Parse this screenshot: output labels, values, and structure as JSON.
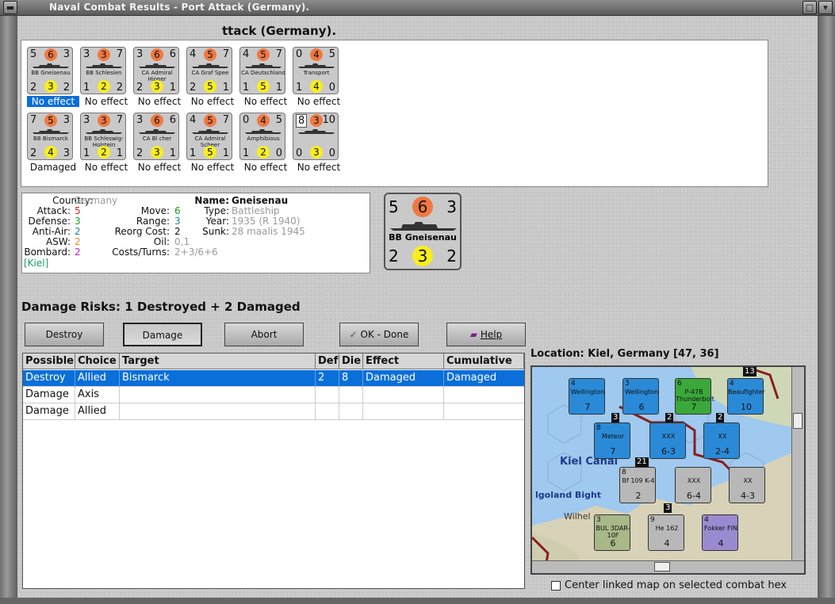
{
  "window": {
    "title": "Naval Combat Results - Port Attack (Germany)."
  },
  "heading": "ttack (Germany).",
  "colors": {
    "orange": "#f07840",
    "yellow": "#f8ee1e",
    "selection": "#0a6fd8",
    "attack": "#d81e1e",
    "defense": "#1a9a1a",
    "antiair": "#1a8aa0",
    "asw": "#e08c1e",
    "bombard": "#c21ec2"
  },
  "units": [
    {
      "top_left": "5",
      "top_mid": "6",
      "top_right": "3",
      "name": "BB Gneisenau",
      "bot_left": "2",
      "bot_mid": "3",
      "bot_right": "2",
      "status": "No effect"
    },
    {
      "top_left": "3",
      "top_mid": "3",
      "top_right": "7",
      "name": "BB Schlesien",
      "bot_left": "1",
      "bot_mid": "2",
      "bot_right": "2",
      "status": "No effect"
    },
    {
      "top_left": "3",
      "top_mid": "6",
      "top_right": "6",
      "name": "CA Admiral Hipper",
      "bot_left": "2",
      "bot_mid": "3",
      "bot_right": "1",
      "status": "No effect"
    },
    {
      "top_left": "4",
      "top_mid": "5",
      "top_right": "7",
      "name": "CA Graf Spee",
      "bot_left": "2",
      "bot_mid": "5",
      "bot_right": "1",
      "status": "No effect"
    },
    {
      "top_left": "4",
      "top_mid": "5",
      "top_right": "7",
      "name": "CA Deutschland",
      "bot_left": "1",
      "bot_mid": "5",
      "bot_right": "1",
      "status": "No effect"
    },
    {
      "top_left": "0",
      "top_mid": "4",
      "top_right": "5",
      "name": "Transport",
      "bot_left": "1",
      "bot_mid": "4",
      "bot_right": "0",
      "status": "No effect"
    },
    {
      "top_left": "7",
      "top_mid": "5",
      "top_right": "3",
      "name": "BB Bismarck",
      "bot_left": "2",
      "bot_mid": "4",
      "bot_right": "3",
      "status": "Damaged"
    },
    {
      "top_left": "3",
      "top_mid": "3",
      "top_right": "7",
      "name": "BB Schleswig-Holstein",
      "bot_left": "1",
      "bot_mid": "2",
      "bot_right": "1",
      "status": "No effect"
    },
    {
      "top_left": "3",
      "top_mid": "6",
      "top_right": "6",
      "name": "CA Bl cher",
      "bot_left": "2",
      "bot_mid": "3",
      "bot_right": "1",
      "status": "No effect"
    },
    {
      "top_left": "4",
      "top_mid": "5",
      "top_right": "7",
      "name": "CA Admiral Scheer",
      "bot_left": "1",
      "bot_mid": "5",
      "bot_right": "1",
      "status": "No effect"
    },
    {
      "top_left": "0",
      "top_mid": "4",
      "top_right": "5",
      "name": "Amphibious",
      "bot_left": "1",
      "bot_mid": "2",
      "bot_right": "0",
      "status": "No effect"
    },
    {
      "top_left": "8",
      "top_mid": "3",
      "top_right": "10",
      "name": "",
      "bot_left": "0",
      "bot_mid": "3",
      "bot_right": "0",
      "status": "No effect"
    }
  ],
  "details": {
    "country_label": "Country:",
    "country": "Germany",
    "attack_label": "Attack:",
    "attack": "5",
    "defense_label": "Defense:",
    "defense": "3",
    "antiair_label": "Anti-Air:",
    "antiair": "2",
    "asw_label": "ASW:",
    "asw": "2",
    "bombard_label": "Bombard:",
    "bombard": "2",
    "location": "[Kiel]",
    "move_label": "Move:",
    "move": "6",
    "range_label": "Range:",
    "range": "3",
    "reorg_label": "Reorg Cost:",
    "reorg": "2",
    "oil_label": "Oil:",
    "oil": "0,1",
    "costs_label": "Costs/Turns:",
    "costs": "2+3/6+6",
    "name_label": "Name:",
    "name": "Gneisenau",
    "type_label": "Type:",
    "type": "Battleship",
    "year_label": "Year:",
    "year": "1935 (R 1940)",
    "sunk_label": "Sunk:",
    "sunk": "28 maalis 1945"
  },
  "big_unit": {
    "top_left": "5",
    "top_mid": "6",
    "top_right": "3",
    "name": "BB Gneisenau",
    "bot_left": "2",
    "bot_mid": "3",
    "bot_right": "2"
  },
  "damage_risks": "Damage Risks:  1 Destroyed + 2 Damaged",
  "buttons": {
    "destroy": "Destroy",
    "damage": "Damage",
    "abort": "Abort",
    "ok": "OK - Done",
    "help": "Help"
  },
  "table": {
    "headers": [
      "Possible",
      "Choice",
      "Target",
      "Def",
      "Die",
      "Effect",
      "Cumulative"
    ],
    "rows": [
      [
        "Destroy",
        "Allied",
        "Bismarck",
        "2",
        "8",
        "Damaged",
        "Damaged"
      ],
      [
        "Damage",
        "Axis",
        "",
        "",
        "",
        "",
        ""
      ],
      [
        "Damage",
        "Allied",
        "",
        "",
        "",
        "",
        ""
      ]
    ]
  },
  "map": {
    "location": "Location:  Kiel, Germany [47, 36]",
    "labels": {
      "kiel": "Kiel Canal",
      "heligoland": "lgoland Bight",
      "wilhelm": "Wilhel"
    },
    "counters": [
      {
        "name": "Wellington",
        "a": "4",
        "b": "7"
      },
      {
        "name": "Wellington",
        "a": "3",
        "b": "6"
      },
      {
        "name": "P-47B Thunderbolt",
        "a": "6",
        "b": "7"
      },
      {
        "name": "Beaufighter",
        "a": "4",
        "b": "10"
      },
      {
        "name": "Meteor",
        "a": "8",
        "b": "7"
      },
      {
        "name": "XXX",
        "a": "",
        "b": "6-3"
      },
      {
        "name": "XX",
        "a": "",
        "b": "2-4"
      },
      {
        "name": "Bf 109 K-4",
        "a": "8",
        "b": "2"
      },
      {
        "name": "XXX",
        "a": "",
        "b": "6-4"
      },
      {
        "name": "XX",
        "a": "",
        "b": "4-3"
      },
      {
        "name": "BUL 3DAR-10F",
        "a": "3",
        "b": "6"
      },
      {
        "name": "He 162",
        "a": "9",
        "b": "4"
      },
      {
        "name": "Fokker FIN",
        "a": "4",
        "b": "4"
      }
    ],
    "stack_numbers": [
      "13",
      "3",
      "2",
      "2",
      "21",
      "3"
    ],
    "checkbox_label": "Center linked map on selected combat hex"
  }
}
